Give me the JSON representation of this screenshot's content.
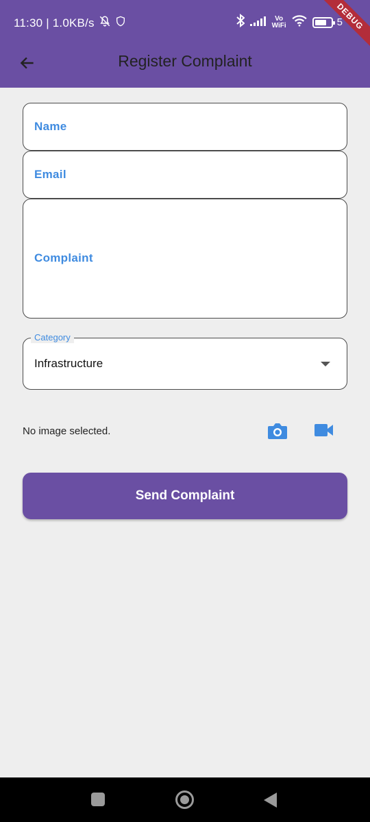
{
  "status_bar": {
    "time_speed": "11:30 | 1.0KB/s",
    "vowifi_top": "Vo",
    "vowifi_bottom": "WiFi",
    "battery_level": "5",
    "debug": "DEBUG"
  },
  "appbar": {
    "title": "Register Complaint"
  },
  "form": {
    "name_label": "Name",
    "email_label": "Email",
    "complaint_label": "Complaint",
    "category_label": "Category",
    "category_value": "Infrastructure"
  },
  "media": {
    "status_text": "No image selected."
  },
  "send_button": {
    "label": "Send Complaint"
  },
  "colors": {
    "primary": "#6a4fa3",
    "accent_blue": "#3f8be0",
    "background": "#eeeeee"
  },
  "icons": [
    "back-arrow-icon",
    "camera-icon",
    "video-camera-icon",
    "bell-off-icon",
    "bluetooth-icon",
    "signal-icon",
    "wifi-icon",
    "battery-icon"
  ]
}
